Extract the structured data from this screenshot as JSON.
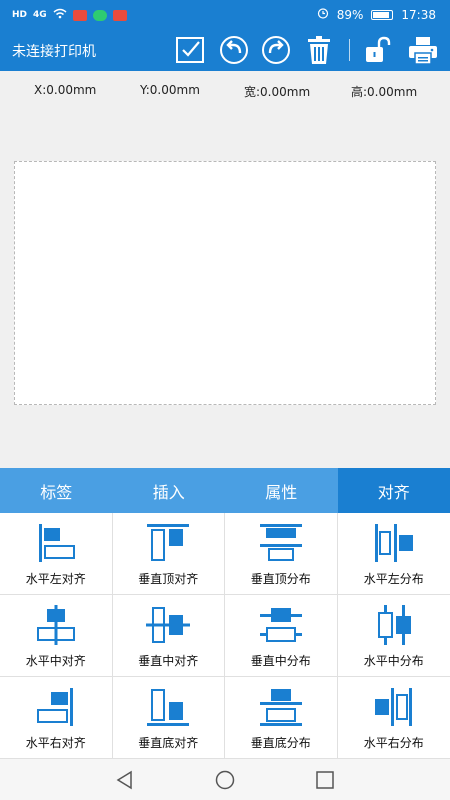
{
  "status_bar": {
    "network": "HD",
    "signal": "4G",
    "battery_text": "89%",
    "battery_level": 0.89,
    "time": "17:38"
  },
  "toolbar": {
    "title": "未连接打印机"
  },
  "coords": {
    "x": "X:0.00mm",
    "y": "Y:0.00mm",
    "width": "宽:0.00mm",
    "height": "高:0.00mm"
  },
  "tabs": [
    {
      "label": "标签"
    },
    {
      "label": "插入"
    },
    {
      "label": "属性"
    },
    {
      "label": "对齐"
    }
  ],
  "align_options": [
    {
      "label": "水平左对齐"
    },
    {
      "label": "垂直顶对齐"
    },
    {
      "label": "垂直顶分布"
    },
    {
      "label": "水平左分布"
    },
    {
      "label": "水平中对齐"
    },
    {
      "label": "垂直中对齐"
    },
    {
      "label": "垂直中分布"
    },
    {
      "label": "水平中分布"
    },
    {
      "label": "水平右对齐"
    },
    {
      "label": "垂直底对齐"
    },
    {
      "label": "垂直底分布"
    },
    {
      "label": "水平右分布"
    }
  ],
  "colors": {
    "primary": "#1a7fd1",
    "tab_bg": "#4a9fe3",
    "icon": "#1a7fd1"
  }
}
